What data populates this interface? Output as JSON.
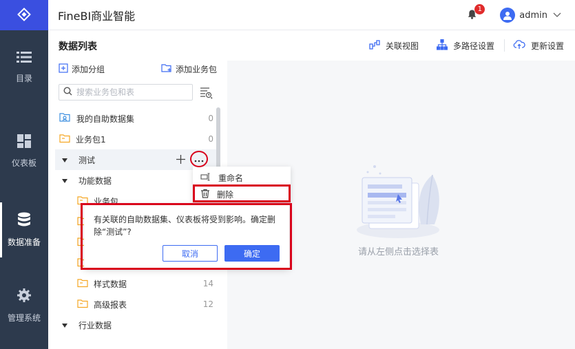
{
  "app": {
    "title": "FineBI商业智能"
  },
  "nav": {
    "items": [
      {
        "label": "目录",
        "icon": "list-icon"
      },
      {
        "label": "仪表板",
        "icon": "dashboard-icon"
      },
      {
        "label": "数据准备",
        "icon": "database-icon",
        "active": true
      },
      {
        "label": "管理系统",
        "icon": "gear-icon"
      }
    ]
  },
  "header": {
    "notification_count": "1",
    "username": "admin"
  },
  "list": {
    "title": "数据列表",
    "add_group": "添加分组",
    "add_package": "添加业务包",
    "search_placeholder": "搜索业务包和表"
  },
  "toolbar": {
    "relation_view": "关联视图",
    "multipath": "多路径设置",
    "update": "更新设置"
  },
  "tree": [
    {
      "name": "我的自助数据集",
      "count": "0",
      "type": "self-dataset"
    },
    {
      "name": "业务包1",
      "count": "0",
      "type": "package"
    },
    {
      "name": "测试",
      "count": "",
      "type": "group",
      "expanded": true
    },
    {
      "name": "功能数据",
      "count": "",
      "type": "group",
      "expanded": true
    },
    {
      "name": "业务包",
      "count": "",
      "type": "package"
    },
    {
      "name": "样式数据",
      "count": "14",
      "type": "package"
    },
    {
      "name": "高级报表",
      "count": "12",
      "type": "package"
    },
    {
      "name": "行业数据",
      "count": "",
      "type": "group",
      "expanded": true
    }
  ],
  "context_menu": {
    "rename": "重命名",
    "delete": "删除"
  },
  "confirm": {
    "message": "有关联的自助数据集、仪表板将受到影响。确定删除“测试”?",
    "cancel": "取消",
    "ok": "确定"
  },
  "empty_state": {
    "text": "请从左侧点击选择表"
  },
  "colors": {
    "nav_bg": "#2d3a4d",
    "accent": "#3d6bf2",
    "annotation": "#d9001b",
    "folder": "#f5a623"
  }
}
